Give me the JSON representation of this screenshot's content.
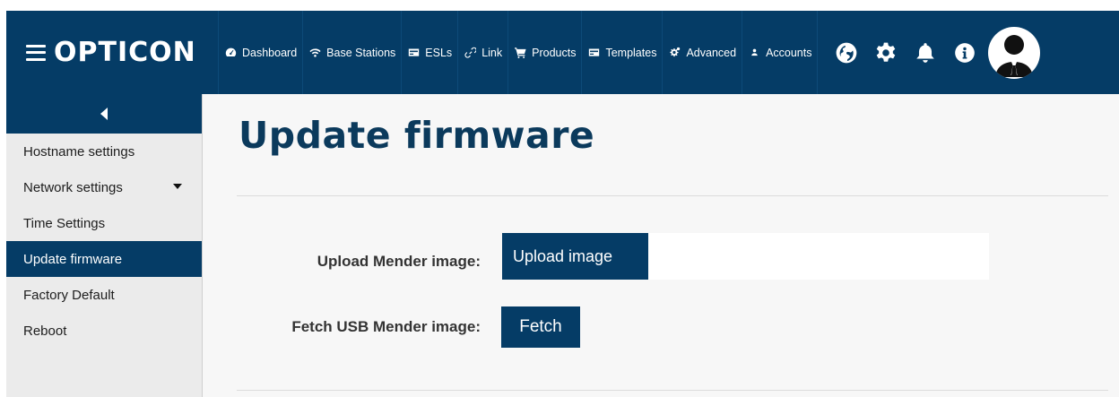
{
  "app": {
    "brand": "OPTICON"
  },
  "nav": {
    "items": [
      {
        "label": "Dashboard",
        "icon": "dashboard-icon"
      },
      {
        "label": "Base Stations",
        "icon": "wifi-icon"
      },
      {
        "label": "ESLs",
        "icon": "card-icon"
      },
      {
        "label": "Link",
        "icon": "link-icon"
      },
      {
        "label": "Products",
        "icon": "cart-icon"
      },
      {
        "label": "Templates",
        "icon": "template-icon"
      },
      {
        "label": "Advanced",
        "icon": "gears-icon"
      },
      {
        "label": "Accounts",
        "icon": "user-icon"
      }
    ],
    "actions": [
      "globe-icon",
      "gear-icon",
      "bell-icon",
      "info-icon",
      "avatar"
    ]
  },
  "sidebar": {
    "items": [
      {
        "label": "Hostname settings",
        "active": false
      },
      {
        "label": "Network settings",
        "active": false,
        "has_submenu": true
      },
      {
        "label": "Time Settings",
        "active": false
      },
      {
        "label": "Update firmware",
        "active": true
      },
      {
        "label": "Factory Default",
        "active": false
      },
      {
        "label": "Reboot",
        "active": false
      }
    ]
  },
  "main": {
    "title": "Update firmware",
    "upload_label": "Upload Mender image:",
    "upload_button": "Upload image",
    "upload_value": "",
    "fetch_label": "Fetch USB Mender image:",
    "fetch_button": "Fetch"
  },
  "colors": {
    "primary": "#053c66",
    "title": "#0b3a5c",
    "background": "#f7f7f7",
    "sidebar": "#ebebeb"
  }
}
